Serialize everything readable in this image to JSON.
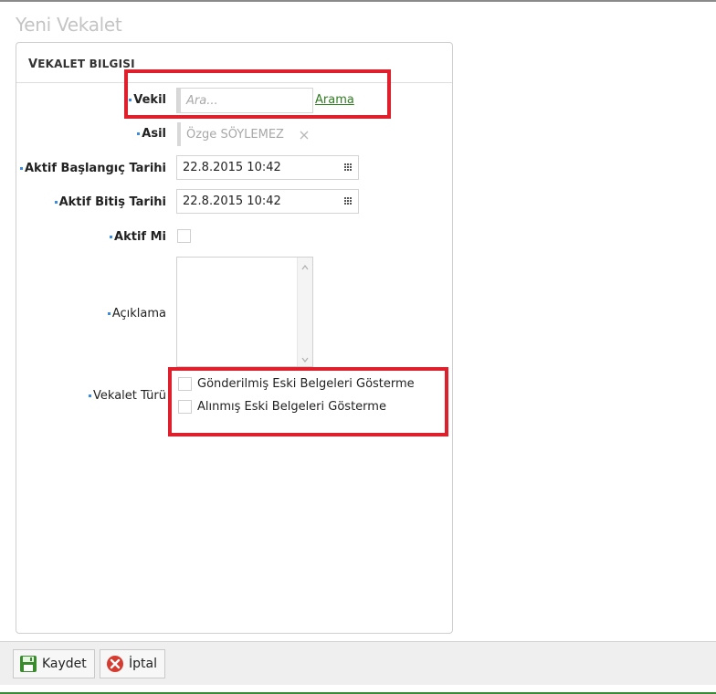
{
  "page": {
    "title": "Yeni Vekalet"
  },
  "panel": {
    "header_first": "V",
    "header_rest": "EKALET BILGISI"
  },
  "form": {
    "vekil": {
      "label": "Vekil",
      "placeholder": "Ara...",
      "link": "Arama"
    },
    "asil": {
      "label": "Asil",
      "value": "Özge SÖYLEMEZ"
    },
    "aktif_baslangic": {
      "label": "Aktif Başlangıç Tarihi",
      "value": "22.8.2015 10:42"
    },
    "aktif_bitis": {
      "label": "Aktif Bitiş Tarihi",
      "value": "22.8.2015 10:42"
    },
    "aktif_mi": {
      "label": "Aktif Mi"
    },
    "aciklama": {
      "label": "Açıklama"
    },
    "vekalet_turu": {
      "label": "Vekalet Türü",
      "options": [
        "Gönderilmiş Eski Belgeleri Gösterme",
        "Alınmış Eski Belgeleri Gösterme"
      ]
    }
  },
  "toolbar": {
    "save_label": "Kaydet",
    "cancel_label": "İptal"
  },
  "colors": {
    "highlight": "#e01f2d",
    "link": "#2e7d1f",
    "required_dot": "#3b8be0"
  },
  "icons": {
    "save": "floppy-disk-icon",
    "cancel": "close-circle-icon",
    "calendar": "calendar-grid-icon",
    "clear": "clear-x-icon"
  }
}
